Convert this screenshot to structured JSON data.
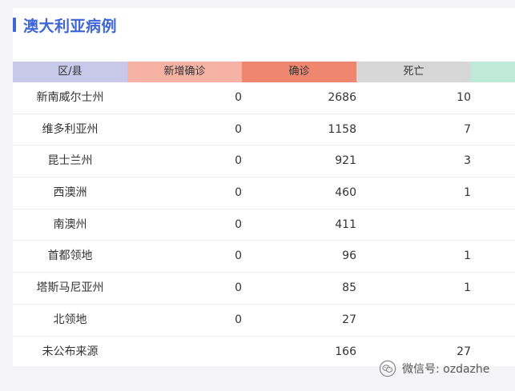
{
  "title": "澳大利亚病例",
  "colors": {
    "accent": "#3f65d6",
    "header_region": "#c8c9ea",
    "header_new": "#f6b3a5",
    "header_confirmed": "#ef8670",
    "header_deaths": "#d7d7d7",
    "header_recovered": "#bfeada"
  },
  "table": {
    "headers": [
      "区/县",
      "新增确诊",
      "确诊",
      "死亡",
      ""
    ],
    "rows": [
      {
        "region": "新南威尔士州",
        "new": "0",
        "confirmed": "2686",
        "deaths": "10"
      },
      {
        "region": "维多利亚州",
        "new": "0",
        "confirmed": "1158",
        "deaths": "7"
      },
      {
        "region": "昆士兰州",
        "new": "0",
        "confirmed": "921",
        "deaths": "3"
      },
      {
        "region": "西澳洲",
        "new": "0",
        "confirmed": "460",
        "deaths": "1"
      },
      {
        "region": "南澳州",
        "new": "0",
        "confirmed": "411",
        "deaths": ""
      },
      {
        "region": "首都领地",
        "new": "0",
        "confirmed": "96",
        "deaths": "1"
      },
      {
        "region": "塔斯马尼亚州",
        "new": "0",
        "confirmed": "85",
        "deaths": "1"
      },
      {
        "region": "北领地",
        "new": "0",
        "confirmed": "27",
        "deaths": ""
      },
      {
        "region": "未公布来源",
        "new": "",
        "confirmed": "166",
        "deaths": "27"
      }
    ]
  },
  "watermark": {
    "icon": "wechat-icon",
    "text": "微信号: ozdazhe"
  }
}
